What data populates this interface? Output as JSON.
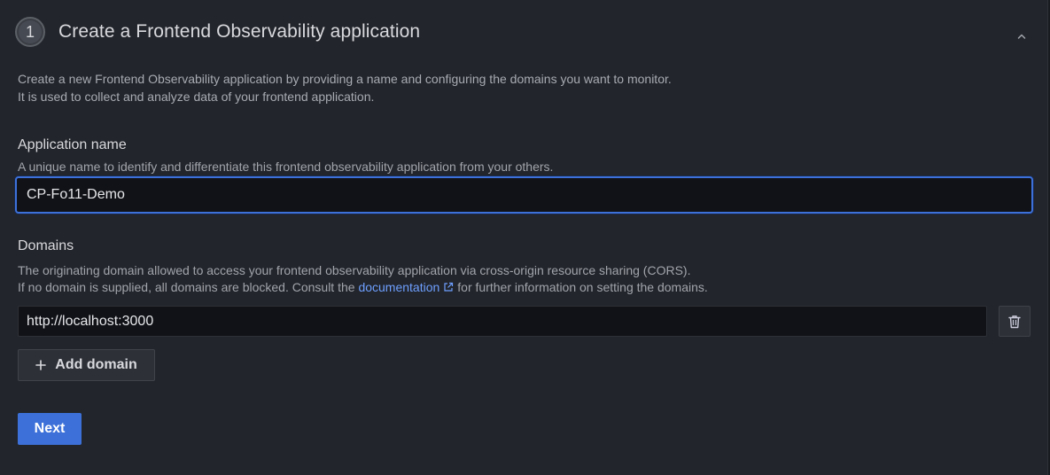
{
  "step": {
    "number": "1",
    "title": "Create a Frontend Observability application",
    "collapse_icon": "chevron-up-icon"
  },
  "intro": {
    "line1": "Create a new Frontend Observability application by providing a name and configuring the domains you want to monitor.",
    "line2": "It is used to collect and analyze data of your frontend application."
  },
  "app_name": {
    "label": "Application name",
    "description": "A unique name to identify and differentiate this frontend observability application from your others.",
    "value": "CP-Fo11-Demo"
  },
  "domains": {
    "label": "Domains",
    "description_line1": "The originating domain allowed to access your frontend observability application via cross-origin resource sharing (CORS).",
    "description_prefix": "If no domain is supplied, all domains are blocked. Consult the",
    "link_text": "documentation",
    "description_suffix": "for further information on setting the domains.",
    "items": [
      "http://localhost:3000"
    ],
    "delete_icon": "trash-icon",
    "add_label": "Add domain",
    "add_icon": "plus-icon"
  },
  "actions": {
    "next_label": "Next"
  },
  "colors": {
    "background": "#22252b",
    "primary": "#3d71d9",
    "link": "#6e9fff"
  }
}
